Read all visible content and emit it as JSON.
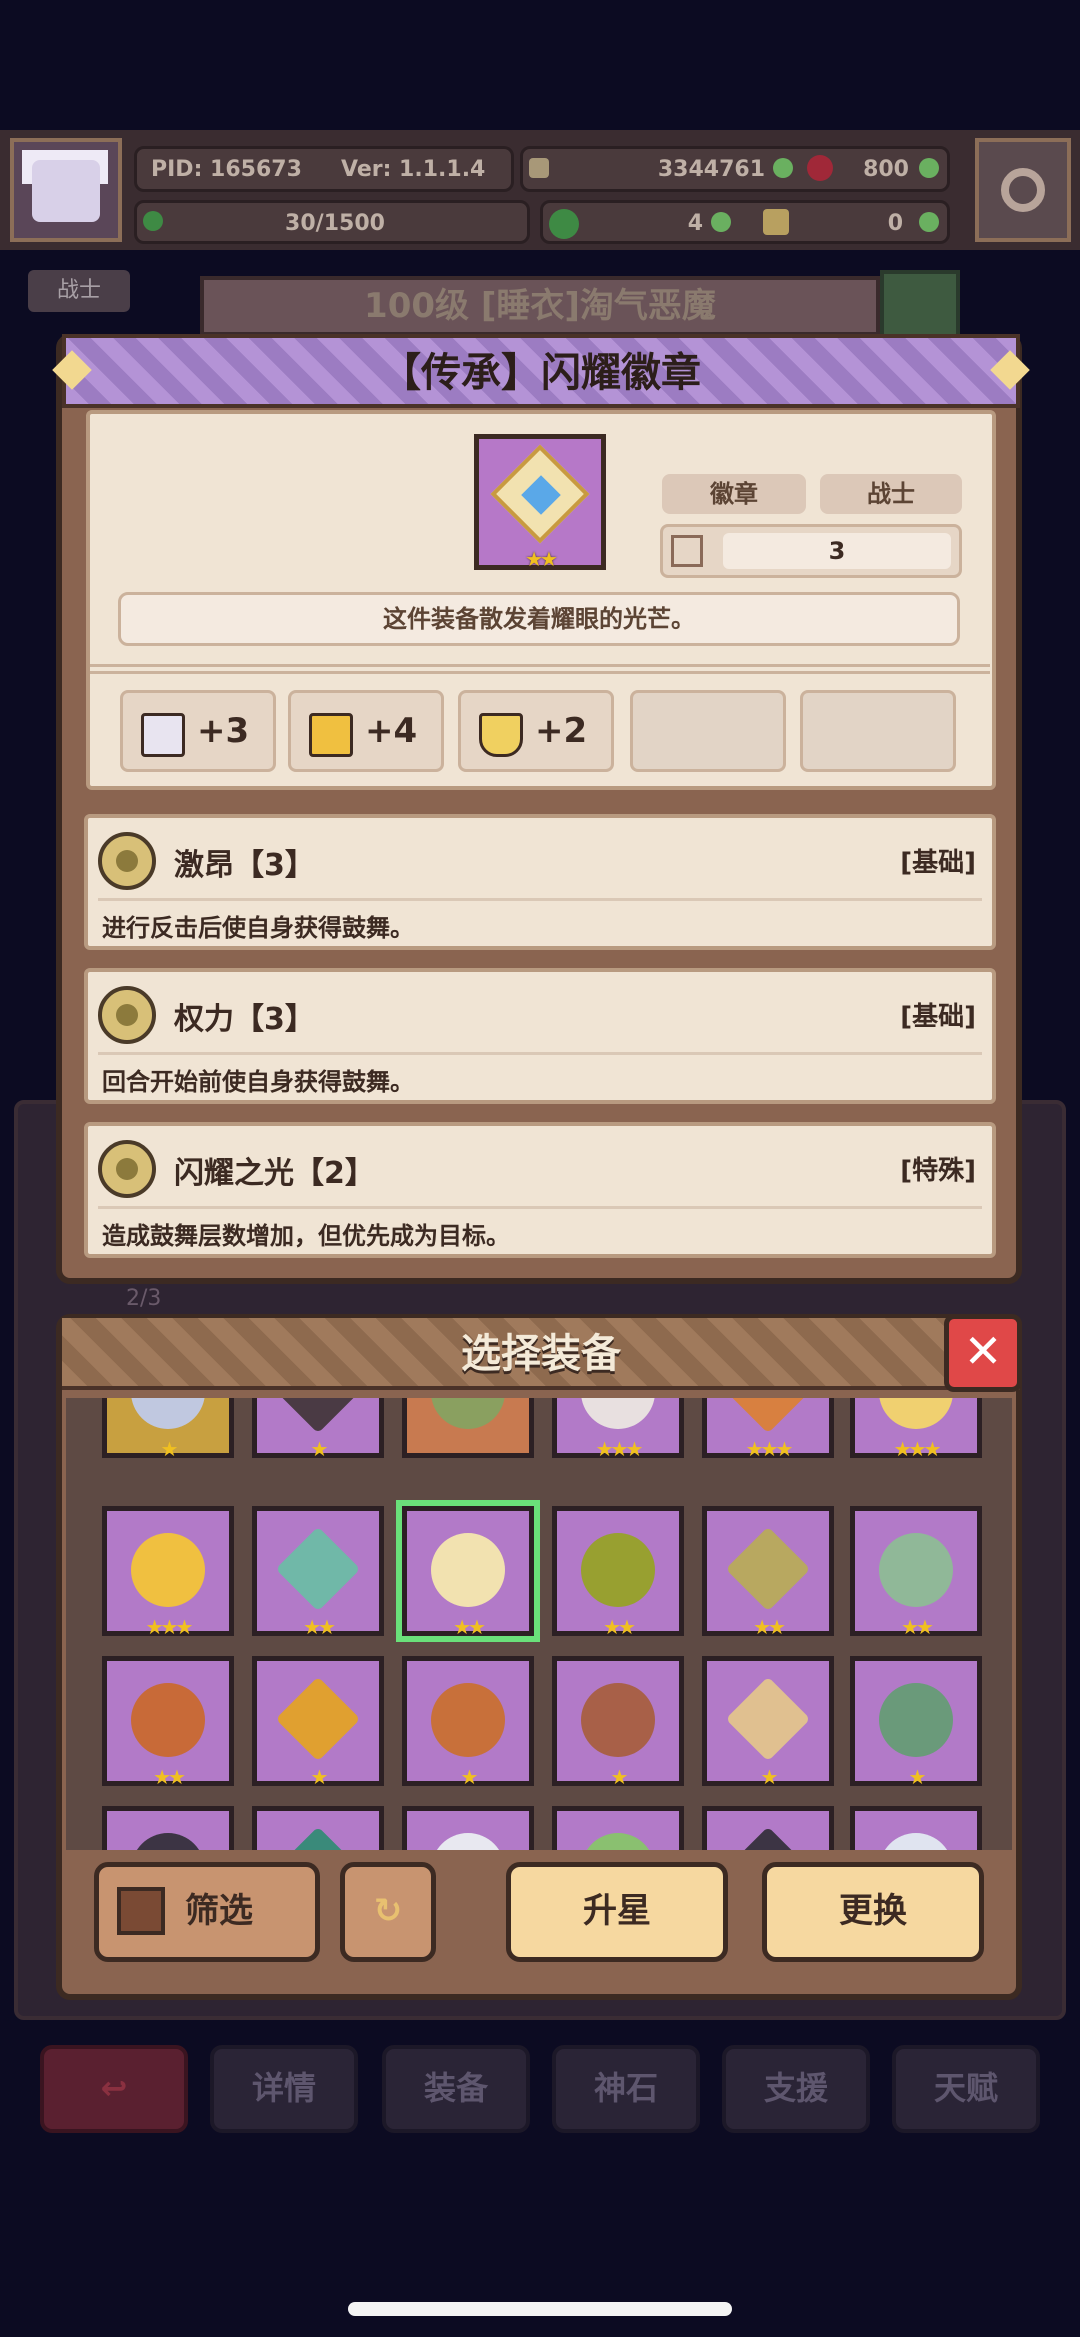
{
  "header": {
    "pid": "PID: 165673",
    "version": "Ver: 1.1.1.4",
    "gold": "3344761",
    "gems": "800",
    "stamina": "30/1500",
    "clover": "4",
    "keys": "0"
  },
  "background": {
    "class_tag": "战士",
    "character_title": "100级 [睡衣]淘气恶魔",
    "page_count": "2/3",
    "nav": [
      "详情",
      "装备",
      "神石",
      "支援",
      "天赋"
    ]
  },
  "item": {
    "title": "【传承】闪耀徽章",
    "type_tag": "徽章",
    "class_tag": "战士",
    "stack_value": "3",
    "description": "这件装备散发着耀眼的光芒。",
    "stars": "★★",
    "stats": [
      {
        "icon": "book-icon",
        "value": "+3",
        "color": "#e8e4f0"
      },
      {
        "icon": "boot-icon",
        "value": "+4",
        "color": "#f0c040"
      },
      {
        "icon": "shield-icon",
        "value": "+2",
        "color": "#f0d060"
      }
    ]
  },
  "skills": [
    {
      "name": "激昂【3】",
      "tag": "[基础]",
      "desc": "进行反击后使自身获得鼓舞。"
    },
    {
      "name": "权力【3】",
      "tag": "[基础]",
      "desc": "回合开始前使自身获得鼓舞。"
    },
    {
      "name": "闪耀之光【2】",
      "tag": "[特殊]",
      "desc": "造成鼓舞层数增加，但优先成为目标。"
    }
  ],
  "equip_panel": {
    "title": "选择装备",
    "close": "✕",
    "buttons": {
      "filter": "筛选",
      "upstar": "升星",
      "replace": "更换"
    }
  },
  "equip_items": [
    {
      "color": "#c8a040",
      "gem": "#c0c8e0",
      "stars": "★"
    },
    {
      "color": "#b27ac8",
      "gem": "#4a3a44",
      "stars": "★"
    },
    {
      "color": "#c87a50",
      "gem": "#8aa060",
      "stars": ""
    },
    {
      "color": "#b27ac8",
      "gem": "#e8e0e0",
      "stars": "★★★"
    },
    {
      "color": "#b27ac8",
      "gem": "#d88040",
      "stars": "★★★"
    },
    {
      "color": "#b27ac8",
      "gem": "#f0d070",
      "stars": "★★★"
    },
    {
      "color": "#b27ac8",
      "gem": "#f0c040",
      "stars": "★★★"
    },
    {
      "color": "#b27ac8",
      "gem": "#70b8a8",
      "stars": "★★"
    },
    {
      "color": "#b27ac8",
      "gem": "#f2e2b0",
      "stars": "★★"
    },
    {
      "color": "#b27ac8",
      "gem": "#98a030",
      "stars": "★★"
    },
    {
      "color": "#b27ac8",
      "gem": "#b8a860",
      "stars": "★★"
    },
    {
      "color": "#b27ac8",
      "gem": "#90b898",
      "stars": "★★"
    },
    {
      "color": "#b27ac8",
      "gem": "#c86a38",
      "stars": "★★"
    },
    {
      "color": "#b27ac8",
      "gem": "#e0a030",
      "stars": "★"
    },
    {
      "color": "#b27ac8",
      "gem": "#c8703a",
      "stars": "★"
    },
    {
      "color": "#b27ac8",
      "gem": "#a86048",
      "stars": "★"
    },
    {
      "color": "#b27ac8",
      "gem": "#e0c090",
      "stars": "★"
    },
    {
      "color": "#b27ac8",
      "gem": "#6a9a7a",
      "stars": "★"
    },
    {
      "color": "#b27ac8",
      "gem": "#3c3444",
      "stars": ""
    },
    {
      "color": "#b27ac8",
      "gem": "#3a8a7a",
      "stars": ""
    },
    {
      "color": "#b27ac8",
      "gem": "#e8e8f0",
      "stars": ""
    },
    {
      "color": "#b27ac8",
      "gem": "#8ac070",
      "stars": ""
    },
    {
      "color": "#b27ac8",
      "gem": "#3c3444",
      "stars": ""
    },
    {
      "color": "#b27ac8",
      "gem": "#e0e4f0",
      "stars": ""
    }
  ],
  "selected_index": 8
}
